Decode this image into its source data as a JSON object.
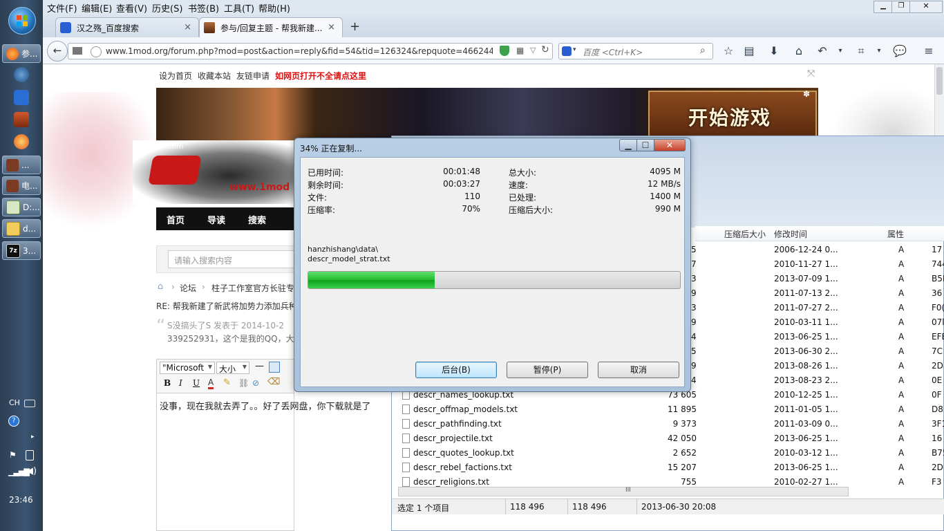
{
  "taskbar": {
    "items": [
      {
        "label": "参..."
      },
      {
        "label": ""
      },
      {
        "label": ""
      },
      {
        "label": ""
      },
      {
        "label": ""
      },
      {
        "label": "..."
      },
      {
        "label": "电..."
      },
      {
        "label": "D:..."
      },
      {
        "label": "d..."
      },
      {
        "label": "3..."
      }
    ],
    "ime": "CH",
    "clock": "23:46"
  },
  "menubar": {
    "items": [
      "文件(F)",
      "编辑(E)",
      "查看(V)",
      "历史(S)",
      "书签(B)",
      "工具(T)",
      "帮助(H)"
    ]
  },
  "tabs": [
    {
      "title": "汉之殇_百度搜索"
    },
    {
      "title": "参与/回复主题 - 帮我新建..."
    }
  ],
  "nav": {
    "url": "www.1mod.org/forum.php?mod=post&action=reply&fid=54&tid=126324&repquote=4662443&",
    "search_engine": "百度",
    "search_placeholder": "百度 <Ctrl+K>"
  },
  "page": {
    "toplinks": [
      "设为首页",
      "收藏本站",
      "友链申请",
      "如网页打开不全请点这里"
    ],
    "banner_text": "开始游戏",
    "banner_tag": "37.com",
    "logo_url_text": "www.1mod",
    "navlinks": [
      "首页",
      "导读",
      "搜索"
    ],
    "search_placeholder": "请输入搜索内容",
    "breadcrumb": [
      "论坛",
      "柱子工作室官方长驻专"
    ],
    "thread_title": "RE: 帮我新建了新武将加势力添加兵种",
    "quote_line1": "S没搞头了S 发表于 2014-10-2",
    "quote_line2": "339252931，这个是我的QQ，大神",
    "font_select": "\"Microsoft",
    "size_select": "大小",
    "editor_text": "没事，现在我就去弄了。。好了丢网盘，你下载就是了"
  },
  "explorer": {
    "columns": [
      "压缩后大小",
      "修改时间",
      "属性"
    ],
    "rows_top": [
      {
        "size_tail": "5",
        "date": "2006-12-24 0...",
        "attr": "A",
        "crc": "17"
      },
      {
        "size_tail": "7",
        "date": "2010-11-27 1...",
        "attr": "A",
        "crc": "744"
      },
      {
        "size_tail": "3",
        "date": "2013-07-09 1...",
        "attr": "A",
        "crc": "B5D"
      },
      {
        "size_tail": "9",
        "date": "2011-07-13 2...",
        "attr": "A",
        "crc": "36"
      },
      {
        "size_tail": "3",
        "date": "2011-07-27 2...",
        "attr": "A",
        "crc": "F0("
      },
      {
        "size_tail": "9",
        "date": "2010-03-11 1...",
        "attr": "A",
        "crc": "07l"
      },
      {
        "size_tail": "4",
        "date": "2013-06-25 1...",
        "attr": "A",
        "crc": "EFE"
      },
      {
        "size_tail": "5",
        "date": "2013-06-30 2...",
        "attr": "A",
        "crc": "7C"
      },
      {
        "size_tail": "9",
        "date": "2013-08-26 1...",
        "attr": "A",
        "crc": "2D"
      },
      {
        "size_tail": "4",
        "date": "2013-08-23 2...",
        "attr": "A",
        "crc": "0E"
      }
    ],
    "rows": [
      {
        "name": "descr_names_lookup.txt",
        "size": "73 605",
        "date": "2010-12-25 1...",
        "attr": "A",
        "crc": "0F"
      },
      {
        "name": "descr_offmap_models.txt",
        "size": "11 895",
        "date": "2011-01-05 1...",
        "attr": "A",
        "crc": "D8"
      },
      {
        "name": "descr_pathfinding.txt",
        "size": "9 373",
        "date": "2011-03-09 0...",
        "attr": "A",
        "crc": "3F1"
      },
      {
        "name": "descr_projectile.txt",
        "size": "42 050",
        "date": "2013-06-25 1...",
        "attr": "A",
        "crc": "16"
      },
      {
        "name": "descr_quotes_lookup.txt",
        "size": "2 652",
        "date": "2010-03-12 1...",
        "attr": "A",
        "crc": "B75"
      },
      {
        "name": "descr_rebel_factions.txt",
        "size": "15 207",
        "date": "2013-06-25 1...",
        "attr": "A",
        "crc": "2D"
      },
      {
        "name": "descr_religions.txt",
        "size": "755",
        "date": "2010-02-27 1...",
        "attr": "A",
        "crc": "F3"
      }
    ],
    "hscroll_grip": "III",
    "status": {
      "selection": "选定 1 个项目",
      "size1": "118 496",
      "size2": "118 496",
      "date": "2013-06-30 20:08"
    }
  },
  "dialog": {
    "title": "34% 正在复制...",
    "progress": 0.34,
    "left_fields": [
      {
        "label": "已用时间:",
        "value": "00:01:48"
      },
      {
        "label": "剩余时间:",
        "value": "00:03:27"
      },
      {
        "label": "文件:",
        "value": "110"
      },
      {
        "label": "压缩率:",
        "value": "70%"
      }
    ],
    "right_fields": [
      {
        "label": "总大小:",
        "value": "4095 M"
      },
      {
        "label": "速度:",
        "value": "12 MB/s"
      },
      {
        "label": "已处理:",
        "value": "1400 M"
      },
      {
        "label": "压缩后大小:",
        "value": "990 M"
      }
    ],
    "path_line1": "hanzhishang\\data\\",
    "path_line2": "descr_model_strat.txt",
    "buttons": {
      "background": "后台(B)",
      "pause": "暂停(P)",
      "cancel": "取消"
    }
  }
}
